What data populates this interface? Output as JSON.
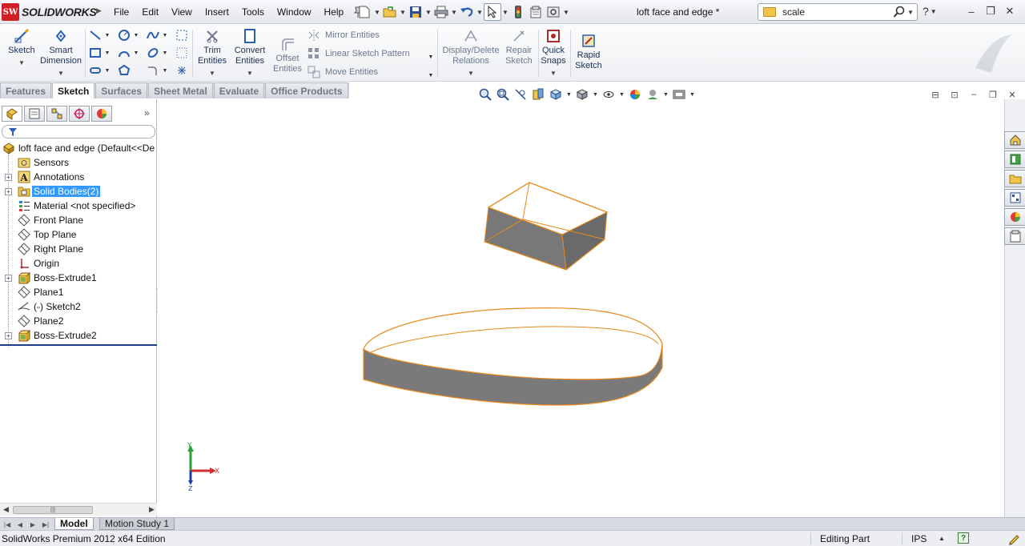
{
  "app": {
    "logo_text": "SOLIDWORKS",
    "logo_mark": "SW",
    "document_title": "loft face and edge *"
  },
  "menu": [
    "File",
    "Edit",
    "View",
    "Insert",
    "Tools",
    "Window",
    "Help"
  ],
  "search": {
    "value": "scale"
  },
  "command_manager": {
    "sketch": "Sketch",
    "smart_dimension_1": "Smart",
    "smart_dimension_2": "Dimension",
    "trim_1": "Trim",
    "trim_2": "Entities",
    "convert_1": "Convert",
    "convert_2": "Entities",
    "offset_1": "Offset",
    "offset_2": "Entities",
    "mirror": "Mirror Entities",
    "linear_pattern": "Linear Sketch Pattern",
    "move": "Move Entities",
    "display_relations_1": "Display/Delete",
    "display_relations_2": "Relations",
    "repair_1": "Repair",
    "repair_2": "Sketch",
    "quick_snaps_1": "Quick",
    "quick_snaps_2": "Snaps",
    "rapid_1": "Rapid",
    "rapid_2": "Sketch"
  },
  "tabs": [
    "Features",
    "Sketch",
    "Surfaces",
    "Sheet Metal",
    "Evaluate",
    "Office Products"
  ],
  "active_tab": "Sketch",
  "feature_tree": {
    "root": "loft face and edge  (Default<<De",
    "items": [
      {
        "label": "Sensors",
        "icon": "sensor-icon",
        "expandable": false
      },
      {
        "label": "Annotations",
        "icon": "annotations-icon",
        "expandable": true
      },
      {
        "label": "Solid Bodies(2)",
        "icon": "solid-bodies-icon",
        "expandable": true,
        "selected": true
      },
      {
        "label": "Material <not specified>",
        "icon": "material-icon",
        "expandable": false
      },
      {
        "label": "Front Plane",
        "icon": "plane-icon",
        "expandable": false
      },
      {
        "label": "Top Plane",
        "icon": "plane-icon",
        "expandable": false
      },
      {
        "label": "Right Plane",
        "icon": "plane-icon",
        "expandable": false
      },
      {
        "label": "Origin",
        "icon": "origin-icon",
        "expandable": false
      },
      {
        "label": "Boss-Extrude1",
        "icon": "extrude-icon",
        "expandable": true
      },
      {
        "label": "Plane1",
        "icon": "plane-icon",
        "expandable": false
      },
      {
        "label": "(-) Sketch2",
        "icon": "sketch-icon",
        "expandable": false
      },
      {
        "label": "Plane2",
        "icon": "plane-icon",
        "expandable": false
      },
      {
        "label": "Boss-Extrude2",
        "icon": "extrude-icon",
        "expandable": true
      }
    ]
  },
  "triad": {
    "x_label": "X",
    "y_label": "Y",
    "z_label": "Z"
  },
  "bottom_tabs": [
    "Model",
    "Motion Study 1"
  ],
  "status": {
    "edition": "SolidWorks Premium 2012 x64 Edition",
    "mode": "Editing Part",
    "units": "IPS",
    "help": "?"
  },
  "colors": {
    "accent_highlight": "#3399ff",
    "edge_highlight": "#e8891c",
    "body_face": "#7d7d7d"
  }
}
